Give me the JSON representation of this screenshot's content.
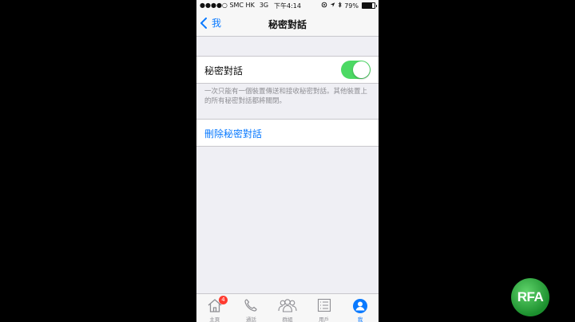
{
  "status_bar": {
    "carrier": "●●●●○ SMC HK",
    "network": "3G",
    "time": "下午4:14",
    "battery": "79%",
    "battery_level": 0.79
  },
  "nav": {
    "back_label": "我",
    "title": "秘密對話"
  },
  "settings": {
    "toggle_label": "秘密對話",
    "toggle_on": true,
    "footnote": "一次只能有一個裝置傳送和接收秘密對話。其他裝置上的所有秘密對話都將關閉。",
    "delete_label": "刪除秘密對話"
  },
  "tabs": [
    {
      "label": "主頁",
      "icon": "home-icon",
      "badge": "4"
    },
    {
      "label": "通話",
      "icon": "phone-icon"
    },
    {
      "label": "群組",
      "icon": "group-icon"
    },
    {
      "label": "用戶",
      "icon": "list-icon"
    },
    {
      "label": "我",
      "icon": "profile-icon",
      "active": true
    }
  ],
  "watermark": {
    "text": "RFA"
  },
  "colors": {
    "accent": "#0a7aff",
    "toggle_on": "#4cd964",
    "badge": "#ff3b30",
    "logo_green": "#2aa83a"
  }
}
